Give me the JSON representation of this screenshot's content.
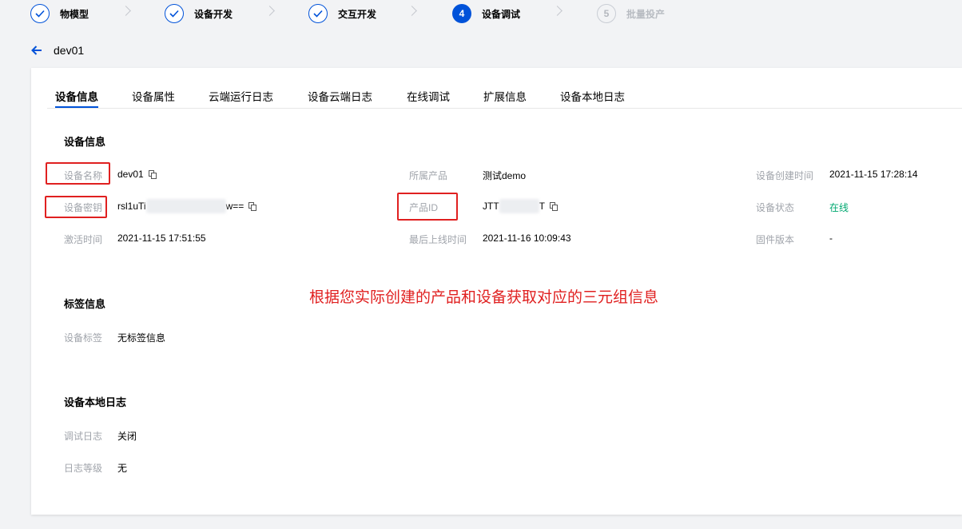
{
  "stepper": {
    "steps": [
      {
        "num": "1",
        "label": "物模型",
        "status": "done"
      },
      {
        "num": "2",
        "label": "设备开发",
        "status": "done"
      },
      {
        "num": "3",
        "label": "交互开发",
        "status": "done"
      },
      {
        "num": "4",
        "label": "设备调试",
        "status": "active"
      },
      {
        "num": "5",
        "label": "批量投产",
        "status": "todo"
      }
    ]
  },
  "header": {
    "device_name": "dev01"
  },
  "tabs": [
    "设备信息",
    "设备属性",
    "云端运行日志",
    "设备云端日志",
    "在线调试",
    "扩展信息",
    "设备本地日志"
  ],
  "device_info": {
    "title": "设备信息",
    "name_label": "设备名称",
    "name_value": "dev01",
    "key_label": "设备密钥",
    "key_prefix": "rsl1uTi",
    "key_suffix": "w==",
    "activated_label": "激活时间",
    "activated_value": "2021-11-15 17:51:55",
    "product_label": "所属产品",
    "product_value": "测试demo",
    "product_id_label": "产品ID",
    "product_id_prefix": "JTT",
    "product_id_suffix": "T",
    "last_online_label": "最后上线时间",
    "last_online_value": "2021-11-16 10:09:43",
    "created_label": "设备创建时间",
    "created_value": "2021-11-15 17:28:14",
    "status_label": "设备状态",
    "status_value": "在线",
    "firmware_label": "固件版本",
    "firmware_value": "-"
  },
  "tag_info": {
    "title": "标签信息",
    "tag_label": "设备标签",
    "tag_value": "无标签信息"
  },
  "local_log": {
    "title": "设备本地日志",
    "debug_label": "调试日志",
    "debug_value": "关闭",
    "level_label": "日志等级",
    "level_value": "无"
  },
  "annotation": "根据您实际创建的产品和设备获取对应的三元组信息",
  "colors": {
    "primary": "#0052d9",
    "online": "#00a870",
    "annotation": "#e02020"
  }
}
